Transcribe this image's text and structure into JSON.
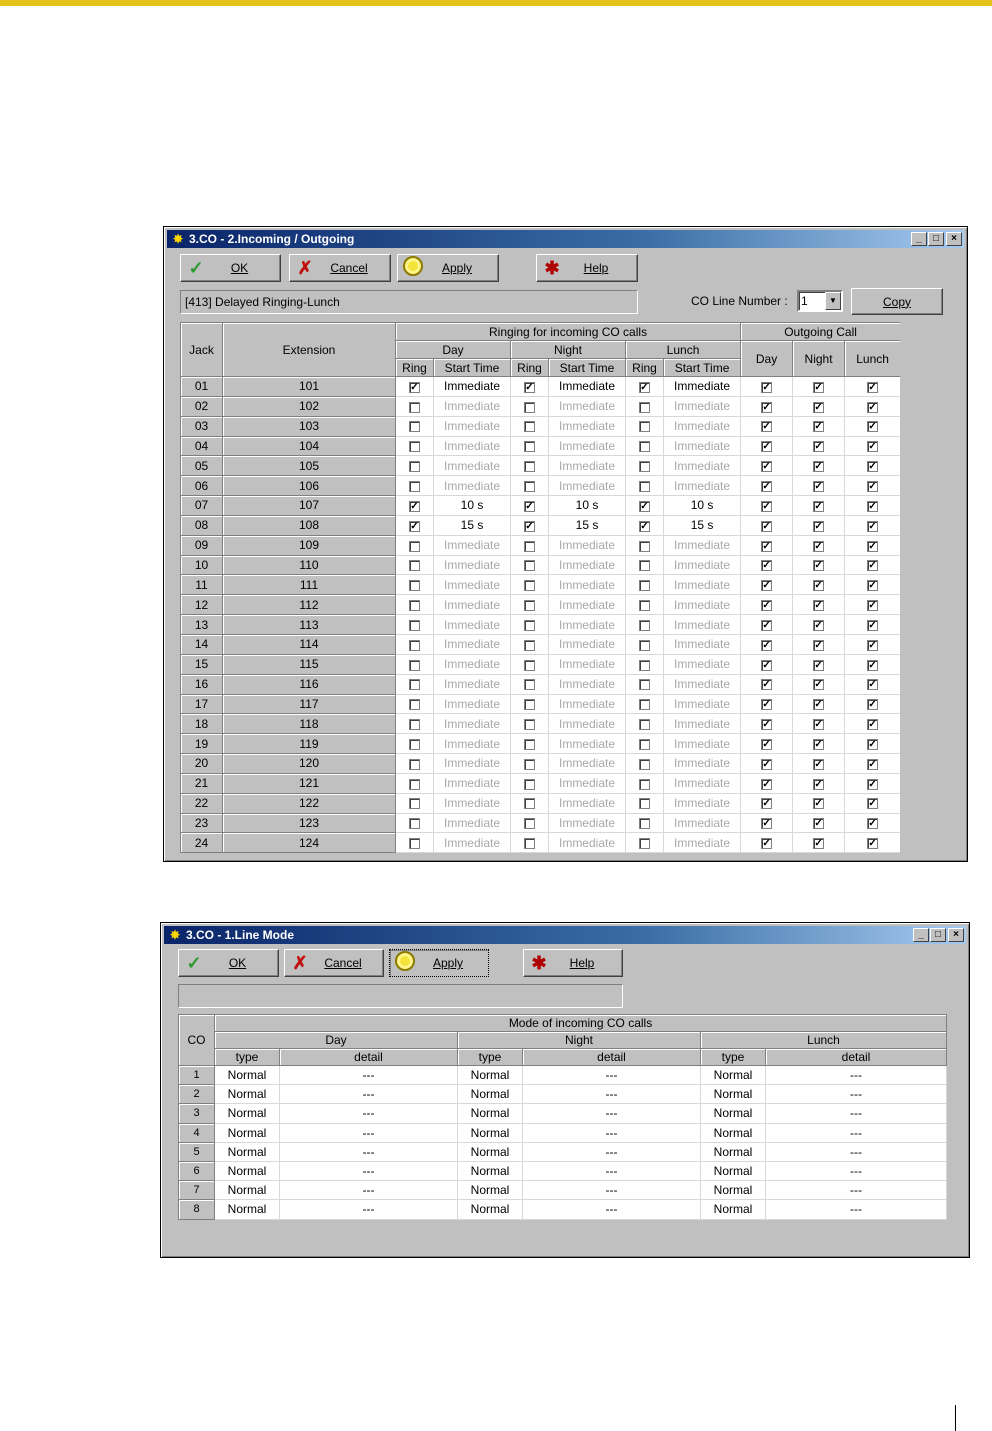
{
  "window1": {
    "title": "3.CO - 2.Incoming / Outgoing",
    "buttons": {
      "ok": "OK",
      "cancel": "Cancel",
      "apply": "Apply",
      "help": "Help"
    },
    "status": "[413] Delayed Ringing-Lunch",
    "co_line_label": "CO Line Number :",
    "co_line_value": "1",
    "copy_label": "Copy",
    "headers": {
      "jack": "Jack",
      "extension": "Extension",
      "ringing": "Ringing for incoming CO calls",
      "outgoing": "Outgoing Call",
      "day": "Day",
      "night": "Night",
      "lunch": "Lunch",
      "ring": "Ring",
      "start_time": "Start Time"
    },
    "rows": [
      {
        "jack": "01",
        "ext": "101",
        "dr": true,
        "dt": "Immediate",
        "nr": true,
        "nt": "Immediate",
        "lr": true,
        "lt": "Immediate",
        "od": true,
        "on": true,
        "ol": true
      },
      {
        "jack": "02",
        "ext": "102",
        "dr": false,
        "dt": "Immediate",
        "nr": false,
        "nt": "Immediate",
        "lr": false,
        "lt": "Immediate",
        "od": true,
        "on": true,
        "ol": true
      },
      {
        "jack": "03",
        "ext": "103",
        "dr": false,
        "dt": "Immediate",
        "nr": false,
        "nt": "Immediate",
        "lr": false,
        "lt": "Immediate",
        "od": true,
        "on": true,
        "ol": true
      },
      {
        "jack": "04",
        "ext": "104",
        "dr": false,
        "dt": "Immediate",
        "nr": false,
        "nt": "Immediate",
        "lr": false,
        "lt": "Immediate",
        "od": true,
        "on": true,
        "ol": true
      },
      {
        "jack": "05",
        "ext": "105",
        "dr": false,
        "dt": "Immediate",
        "nr": false,
        "nt": "Immediate",
        "lr": false,
        "lt": "Immediate",
        "od": true,
        "on": true,
        "ol": true
      },
      {
        "jack": "06",
        "ext": "106",
        "dr": false,
        "dt": "Immediate",
        "nr": false,
        "nt": "Immediate",
        "lr": false,
        "lt": "Immediate",
        "od": true,
        "on": true,
        "ol": true
      },
      {
        "jack": "07",
        "ext": "107",
        "dr": true,
        "dt": "10 s",
        "nr": true,
        "nt": "10 s",
        "lr": true,
        "lt": "10 s",
        "od": true,
        "on": true,
        "ol": true
      },
      {
        "jack": "08",
        "ext": "108",
        "dr": true,
        "dt": "15 s",
        "nr": true,
        "nt": "15 s",
        "lr": true,
        "lt": "15 s",
        "od": true,
        "on": true,
        "ol": true
      },
      {
        "jack": "09",
        "ext": "109",
        "dr": false,
        "dt": "Immediate",
        "nr": false,
        "nt": "Immediate",
        "lr": false,
        "lt": "Immediate",
        "od": true,
        "on": true,
        "ol": true
      },
      {
        "jack": "10",
        "ext": "110",
        "dr": false,
        "dt": "Immediate",
        "nr": false,
        "nt": "Immediate",
        "lr": false,
        "lt": "Immediate",
        "od": true,
        "on": true,
        "ol": true
      },
      {
        "jack": "11",
        "ext": "111",
        "dr": false,
        "dt": "Immediate",
        "nr": false,
        "nt": "Immediate",
        "lr": false,
        "lt": "Immediate",
        "od": true,
        "on": true,
        "ol": true
      },
      {
        "jack": "12",
        "ext": "112",
        "dr": false,
        "dt": "Immediate",
        "nr": false,
        "nt": "Immediate",
        "lr": false,
        "lt": "Immediate",
        "od": true,
        "on": true,
        "ol": true
      },
      {
        "jack": "13",
        "ext": "113",
        "dr": false,
        "dt": "Immediate",
        "nr": false,
        "nt": "Immediate",
        "lr": false,
        "lt": "Immediate",
        "od": true,
        "on": true,
        "ol": true
      },
      {
        "jack": "14",
        "ext": "114",
        "dr": false,
        "dt": "Immediate",
        "nr": false,
        "nt": "Immediate",
        "lr": false,
        "lt": "Immediate",
        "od": true,
        "on": true,
        "ol": true
      },
      {
        "jack": "15",
        "ext": "115",
        "dr": false,
        "dt": "Immediate",
        "nr": false,
        "nt": "Immediate",
        "lr": false,
        "lt": "Immediate",
        "od": true,
        "on": true,
        "ol": true
      },
      {
        "jack": "16",
        "ext": "116",
        "dr": false,
        "dt": "Immediate",
        "nr": false,
        "nt": "Immediate",
        "lr": false,
        "lt": "Immediate",
        "od": true,
        "on": true,
        "ol": true
      },
      {
        "jack": "17",
        "ext": "117",
        "dr": false,
        "dt": "Immediate",
        "nr": false,
        "nt": "Immediate",
        "lr": false,
        "lt": "Immediate",
        "od": true,
        "on": true,
        "ol": true
      },
      {
        "jack": "18",
        "ext": "118",
        "dr": false,
        "dt": "Immediate",
        "nr": false,
        "nt": "Immediate",
        "lr": false,
        "lt": "Immediate",
        "od": true,
        "on": true,
        "ol": true
      },
      {
        "jack": "19",
        "ext": "119",
        "dr": false,
        "dt": "Immediate",
        "nr": false,
        "nt": "Immediate",
        "lr": false,
        "lt": "Immediate",
        "od": true,
        "on": true,
        "ol": true
      },
      {
        "jack": "20",
        "ext": "120",
        "dr": false,
        "dt": "Immediate",
        "nr": false,
        "nt": "Immediate",
        "lr": false,
        "lt": "Immediate",
        "od": true,
        "on": true,
        "ol": true
      },
      {
        "jack": "21",
        "ext": "121",
        "dr": false,
        "dt": "Immediate",
        "nr": false,
        "nt": "Immediate",
        "lr": false,
        "lt": "Immediate",
        "od": true,
        "on": true,
        "ol": true
      },
      {
        "jack": "22",
        "ext": "122",
        "dr": false,
        "dt": "Immediate",
        "nr": false,
        "nt": "Immediate",
        "lr": false,
        "lt": "Immediate",
        "od": true,
        "on": true,
        "ol": true
      },
      {
        "jack": "23",
        "ext": "123",
        "dr": false,
        "dt": "Immediate",
        "nr": false,
        "nt": "Immediate",
        "lr": false,
        "lt": "Immediate",
        "od": true,
        "on": true,
        "ol": true
      },
      {
        "jack": "24",
        "ext": "124",
        "dr": false,
        "dt": "Immediate",
        "nr": false,
        "nt": "Immediate",
        "lr": false,
        "lt": "Immediate",
        "od": true,
        "on": true,
        "ol": true
      }
    ]
  },
  "window2": {
    "title": "3.CO - 1.Line Mode",
    "buttons": {
      "ok": "OK",
      "cancel": "Cancel",
      "apply": "Apply",
      "help": "Help"
    },
    "status": "",
    "headers": {
      "co": "CO",
      "mode": "Mode of incoming CO calls",
      "day": "Day",
      "night": "Night",
      "lunch": "Lunch",
      "type": "type",
      "detail": "detail"
    },
    "rows": [
      {
        "co": "1",
        "dt": "Normal",
        "dd": "---",
        "nt": "Normal",
        "nd": "---",
        "lt": "Normal",
        "ld": "---"
      },
      {
        "co": "2",
        "dt": "Normal",
        "dd": "---",
        "nt": "Normal",
        "nd": "---",
        "lt": "Normal",
        "ld": "---"
      },
      {
        "co": "3",
        "dt": "Normal",
        "dd": "---",
        "nt": "Normal",
        "nd": "---",
        "lt": "Normal",
        "ld": "---"
      },
      {
        "co": "4",
        "dt": "Normal",
        "dd": "---",
        "nt": "Normal",
        "nd": "---",
        "lt": "Normal",
        "ld": "---"
      },
      {
        "co": "5",
        "dt": "Normal",
        "dd": "---",
        "nt": "Normal",
        "nd": "---",
        "lt": "Normal",
        "ld": "---"
      },
      {
        "co": "6",
        "dt": "Normal",
        "dd": "---",
        "nt": "Normal",
        "nd": "---",
        "lt": "Normal",
        "ld": "---"
      },
      {
        "co": "7",
        "dt": "Normal",
        "dd": "---",
        "nt": "Normal",
        "nd": "---",
        "lt": "Normal",
        "ld": "---"
      },
      {
        "co": "8",
        "dt": "Normal",
        "dd": "---",
        "nt": "Normal",
        "nd": "---",
        "lt": "Normal",
        "ld": "---"
      }
    ]
  },
  "colors": {
    "accent_bar": "#e5c21a",
    "titlebar": "#0a246a",
    "window_bg": "#c0c0c0"
  },
  "icons": {
    "ok": "checkmark-icon",
    "cancel": "x-icon",
    "apply": "circle-icon",
    "help": "help-icon"
  }
}
